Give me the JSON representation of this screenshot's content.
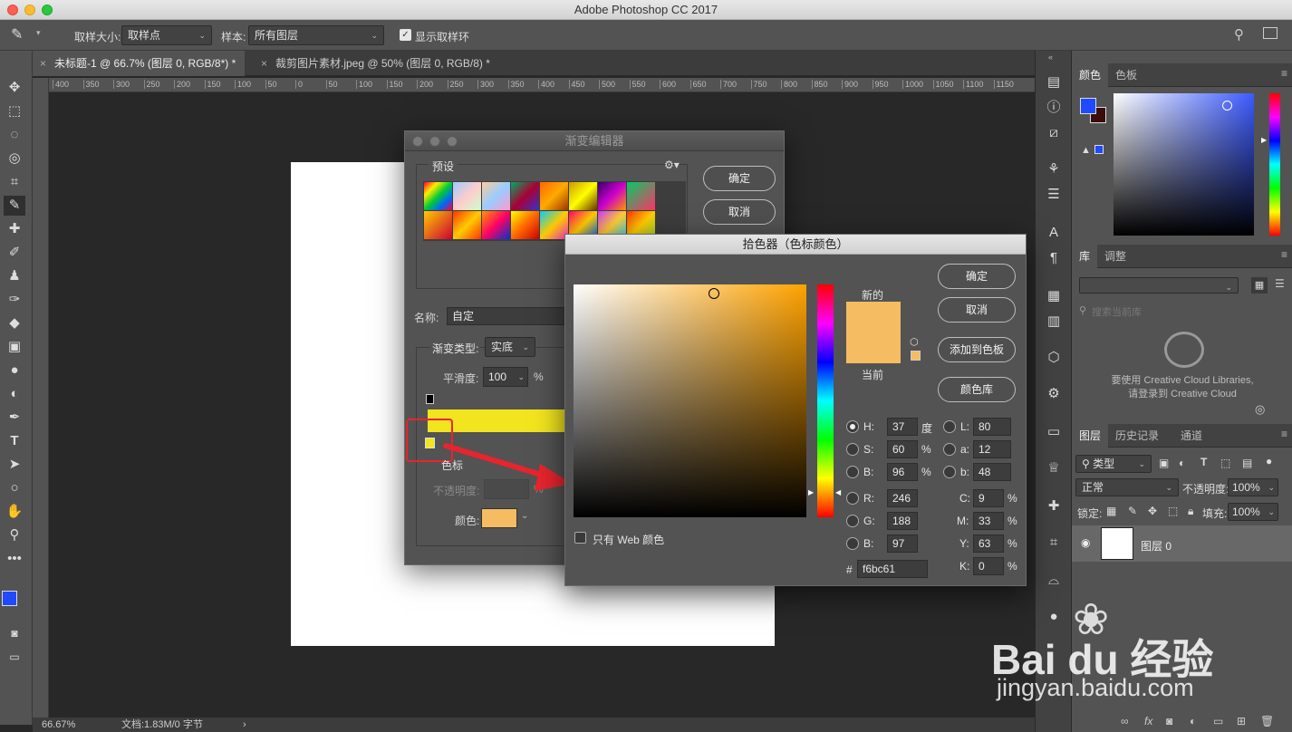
{
  "app": {
    "title": "Adobe Photoshop CC 2017"
  },
  "options": {
    "sample_size_label": "取样大小:",
    "sample_size_value": "取样点",
    "sample_label": "样本:",
    "sample_value": "所有图层",
    "show_ring_label": "显示取样环"
  },
  "tabs": [
    {
      "label": "未标题-1 @ 66.7% (图层 0, RGB/8*) *"
    },
    {
      "label": "裁剪图片素材.jpeg @ 50% (图层 0, RGB/8) *"
    }
  ],
  "ruler": {
    "ticks": [
      "400",
      "350",
      "300",
      "250",
      "200",
      "150",
      "100",
      "50",
      "0",
      "50",
      "100",
      "150",
      "200",
      "250",
      "300",
      "350",
      "400",
      "450",
      "500",
      "550",
      "600",
      "650",
      "700",
      "750",
      "800",
      "850",
      "900",
      "950",
      "1000",
      "1050",
      "1100",
      "1150"
    ]
  },
  "status": {
    "zoom": "66.67%",
    "doc": "文档:1.83M/0 字节"
  },
  "gradient_editor": {
    "title": "渐变编辑器",
    "preset_label": "预设",
    "ok": "确定",
    "cancel": "取消",
    "name_label": "名称:",
    "name_value": "自定",
    "type_label": "渐变类型:",
    "type_value": "实底",
    "smooth_label": "平滑度:",
    "smooth_value": "100",
    "percent": "%",
    "stops_label": "色标",
    "opacity_label": "不透明度:",
    "color_label": "颜色:",
    "colors": {
      "bar": "#f2e41e",
      "stop": "#f6bc61",
      "highlight": "#e8242e"
    }
  },
  "color_picker": {
    "title": "拾色器（色标颜色）",
    "ok": "确定",
    "cancel": "取消",
    "add_swatch": "添加到色板",
    "color_libraries": "颜色库",
    "new_label": "新的",
    "current_label": "当前",
    "web_only": "只有 Web 颜色",
    "hex_label": "#",
    "hex": "f6bc61",
    "hsb": {
      "h_label": "H:",
      "h": "37",
      "h_unit": "度",
      "s_label": "S:",
      "s": "60",
      "s_unit": "%",
      "b_label": "B:",
      "b": "96",
      "b_unit": "%"
    },
    "rgb": {
      "r_label": "R:",
      "r": "246",
      "g_label": "G:",
      "g": "188",
      "b_label": "B:",
      "b": "97"
    },
    "lab": {
      "l_label": "L:",
      "l": "80",
      "a_label": "a:",
      "a": "12",
      "b_label": "b:",
      "b": "48"
    },
    "cmyk": {
      "c_label": "C:",
      "c": "9",
      "m_label": "M:",
      "m": "33",
      "y_label": "Y:",
      "y": "63",
      "k_label": "K:",
      "k": "0",
      "unit": "%"
    },
    "new_color": "#f6bc61",
    "hue_color": "#ffa200"
  },
  "panels": {
    "color_tabs": [
      "颜色",
      "色板"
    ],
    "lib_tabs": [
      "库",
      "调整"
    ],
    "lib_search": "搜索当前库",
    "lib_msg1": "要使用 Creative Cloud Libraries,",
    "lib_msg2": "请登录到 Creative Cloud",
    "layer_tabs": [
      "图层",
      "历史记录",
      "通道"
    ],
    "kind": "类型",
    "blend": "正常",
    "opacity_label": "不透明度:",
    "opacity": "100%",
    "lock_label": "锁定:",
    "fill_label": "填充:",
    "fill": "100%",
    "layer_name": "图层 0",
    "fg_color": "#1f4aff",
    "bg_color": "#3a0c0c"
  },
  "watermark": {
    "brand": "Bai du 经验",
    "url": "jingyan.baidu.com"
  }
}
